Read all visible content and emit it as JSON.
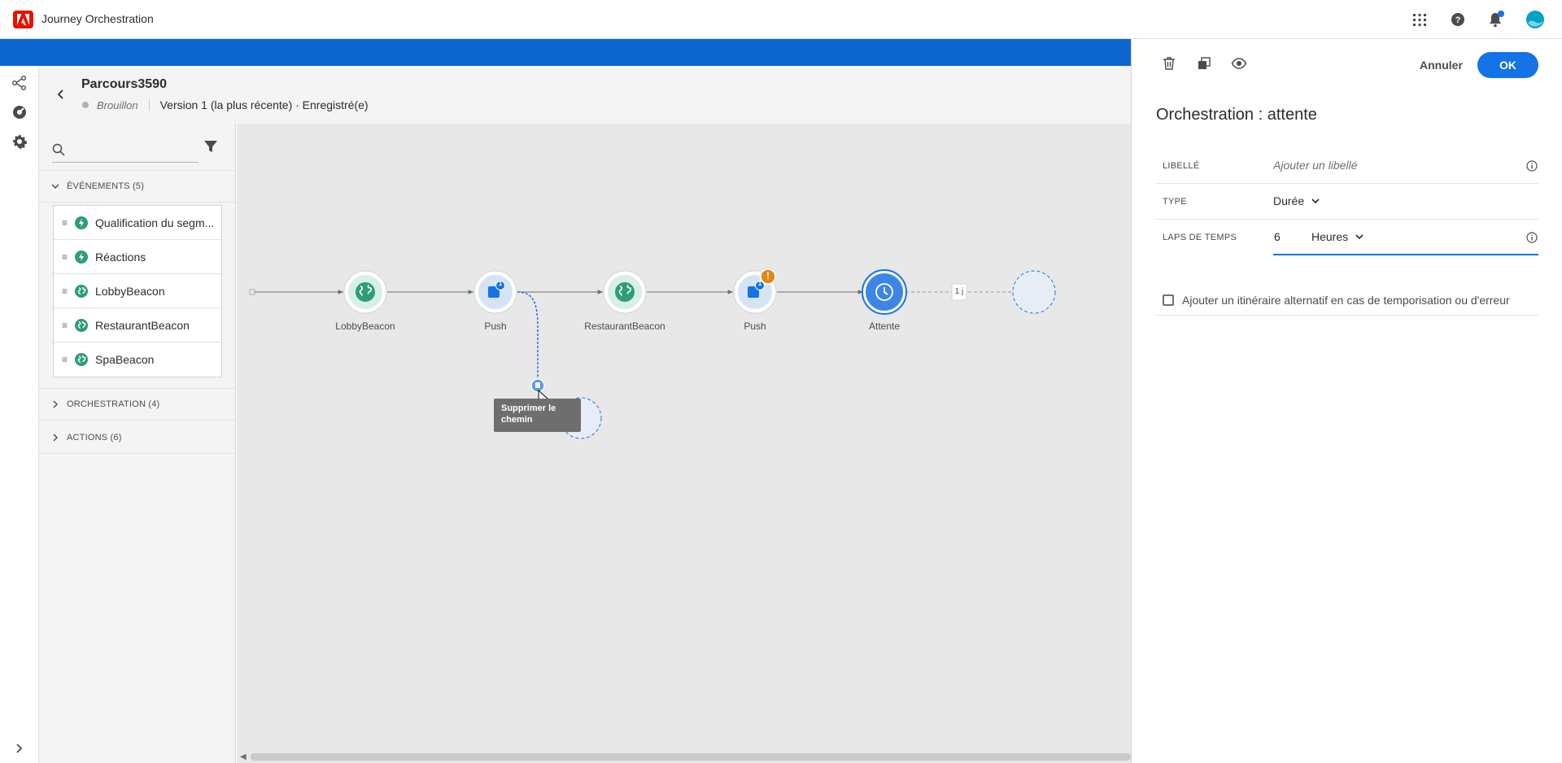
{
  "app": {
    "title": "Journey Orchestration"
  },
  "journey": {
    "name": "Parcours3590",
    "status": "Brouillon",
    "version": "Version 1 (la plus récente) · Enregistré(e)"
  },
  "palette": {
    "search_placeholder": "",
    "sections": {
      "events": {
        "label": "ÉVÉNEMENTS (5)"
      },
      "orchestration": {
        "label": "ORCHESTRATION (4)"
      },
      "actions": {
        "label": "ACTIONS (6)"
      }
    },
    "events": [
      {
        "label": "Qualification du segm...",
        "icon": "lightning-icon"
      },
      {
        "label": "Réactions",
        "icon": "lightning-icon"
      },
      {
        "label": "LobbyBeacon",
        "icon": "globe-icon"
      },
      {
        "label": "RestaurantBeacon",
        "icon": "globe-icon"
      },
      {
        "label": "SpaBeacon",
        "icon": "globe-icon"
      }
    ]
  },
  "canvas": {
    "nodes": [
      {
        "label": "LobbyBeacon",
        "kind": "event"
      },
      {
        "label": "Push",
        "kind": "action",
        "badge": "1"
      },
      {
        "label": "RestaurantBeacon",
        "kind": "event"
      },
      {
        "label": "Push",
        "kind": "action",
        "badge": "1",
        "warning": "!"
      },
      {
        "label": "Attente",
        "kind": "wait"
      }
    ],
    "wait_duration_label": "1 j",
    "tooltip": {
      "line1": "Supprimer le",
      "line2": "chemin"
    }
  },
  "properties": {
    "cancel_label": "Annuler",
    "ok_label": "OK",
    "title": "Orchestration : attente",
    "label_field": {
      "label": "LIBELLÉ",
      "placeholder": "Ajouter un libellé"
    },
    "type_field": {
      "label": "TYPE",
      "value": "Durée"
    },
    "time_field": {
      "label": "LAPS DE TEMPS",
      "amount": "6",
      "unit": "Heures"
    },
    "alt_path_checkbox": {
      "label": "Ajouter un itinéraire alternatif en cas de temporisation ou d'erreur",
      "checked": false
    }
  },
  "colors": {
    "accent": "#1473e6",
    "band": "#0d66d0",
    "event_node": "#2d9d78",
    "warning": "#e68619",
    "brand": "#eb1000"
  }
}
